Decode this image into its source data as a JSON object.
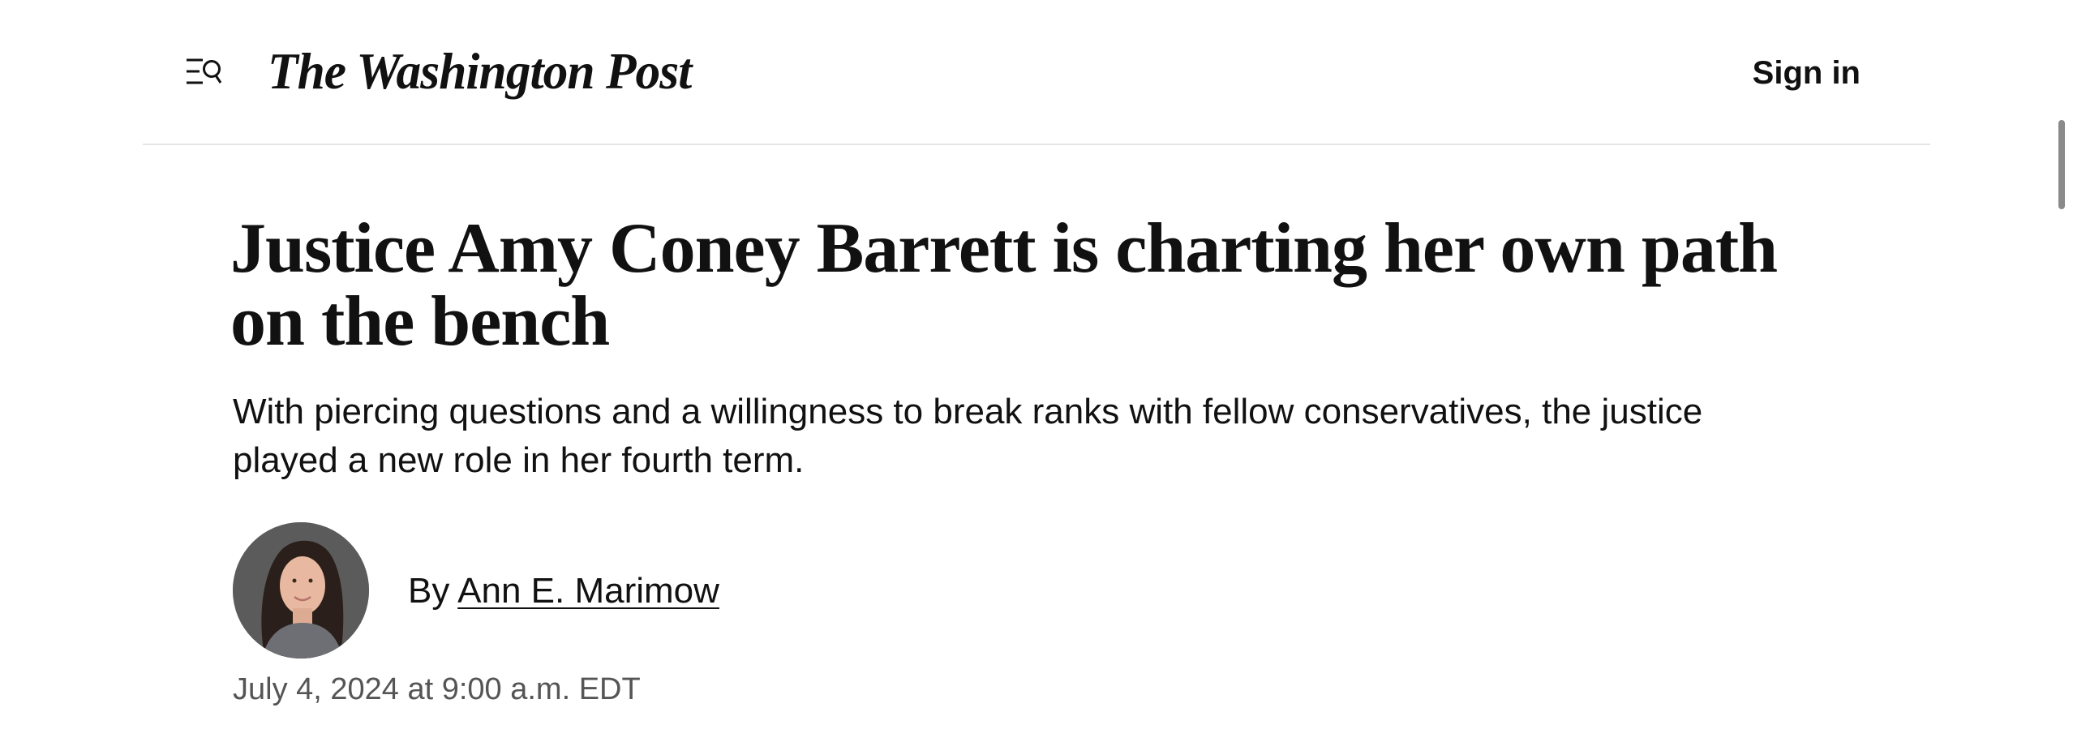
{
  "header": {
    "logo_text": "The Washington Post",
    "signin_label": "Sign in",
    "menu_icon": "menu-search-icon"
  },
  "article": {
    "headline": "Justice Amy Coney Barrett is charting her own path on the bench",
    "dek": "With piercing questions and a willingness to break ranks with fellow conservatives, the justice played a new role in her fourth term.",
    "byline_prefix": "By",
    "author_name": "Ann E. Marimow",
    "timestamp": "July 4, 2024 at 9:00 a.m. EDT"
  },
  "colors": {
    "text": "#111111",
    "muted": "#555555",
    "divider": "#e5e5e5",
    "background": "#ffffff"
  }
}
